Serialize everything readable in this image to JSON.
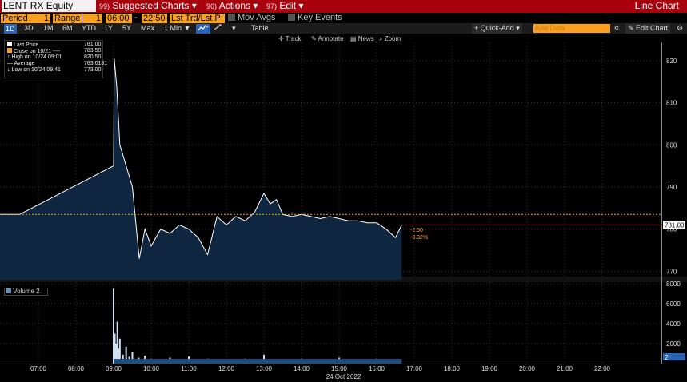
{
  "topbar": {
    "ticker": "LENT RX Equity",
    "menus": [
      {
        "num": "99)",
        "label": "Suggested Charts",
        "caret": "▾"
      },
      {
        "num": "96)",
        "label": "Actions",
        "caret": "▾"
      },
      {
        "num": "97)",
        "label": "Edit",
        "caret": "▾"
      }
    ],
    "title": "Line Chart"
  },
  "bar2": {
    "period_label": "Period",
    "period_value": "1",
    "range_label": "Range",
    "range_value": "1",
    "time_from": "06:00",
    "dash": "-",
    "time_to": "22:50",
    "field": "Lst Trd/Lst P",
    "mov_avgs": "Mov Avgs",
    "key_events": "Key Events"
  },
  "bar3": {
    "ranges": [
      "1D",
      "3D",
      "1M",
      "6M",
      "YTD",
      "1Y",
      "5Y",
      "Max"
    ],
    "selected": "1D",
    "interval": "1 Min ▼",
    "table": "Table",
    "quick_add": "+ Quick-Add ▾",
    "add_data_placeholder": "Add Data",
    "collapse": "«",
    "edit_chart": "✎ Edit Chart",
    "gear": "⚙"
  },
  "tools": {
    "track": "Track",
    "annotate": "Annotate",
    "news": "News",
    "zoom": "Zoom"
  },
  "legend": {
    "rows": [
      {
        "label": "Last Price",
        "value": "781.00",
        "color": "#ffffff"
      },
      {
        "label": "Close on 10/21 ----",
        "value": "783.50",
        "color": "#f9a020"
      },
      {
        "label": "High on 10/24 09:01",
        "value": "820.50",
        "color": ""
      },
      {
        "label": "Average",
        "value": "783.0131",
        "color": ""
      },
      {
        "label": "Low on 10/24 09:41",
        "value": "773.00",
        "color": ""
      }
    ]
  },
  "annotations": {
    "change": "-2.50",
    "change_pct": "-0.32%",
    "last_badge": "781.00"
  },
  "volume": {
    "legend": "Volume",
    "legend_count": "2",
    "badge": "2"
  },
  "date_label": "24 Oct 2022",
  "colors": {
    "topbar": "#a8000c",
    "accent_orange": "#f9a020",
    "area_fill": "#0f2640",
    "line": "#ffffff",
    "volume_fill": "#1f4d80"
  },
  "chart_data": [
    {
      "type": "area",
      "title": "",
      "x": [
        "06:30",
        "09:00",
        "09:01",
        "09:05",
        "09:10",
        "09:20",
        "09:30",
        "09:41",
        "09:50",
        "10:00",
        "10:15",
        "10:30",
        "10:45",
        "11:00",
        "11:15",
        "11:30",
        "11:45",
        "12:00",
        "12:15",
        "12:30",
        "12:45",
        "13:00",
        "13:10",
        "13:20",
        "13:30",
        "13:45",
        "14:00",
        "14:15",
        "14:30",
        "14:45",
        "15:00",
        "15:15",
        "15:30",
        "15:45",
        "16:00",
        "16:15",
        "16:30",
        "16:40"
      ],
      "series": [
        {
          "name": "",
          "values": [
            783.5,
            795.0,
            820.5,
            814.0,
            800.0,
            795.0,
            790.0,
            773.0,
            780.0,
            776.0,
            780.0,
            779.0,
            781.0,
            780.0,
            778.0,
            774.0,
            783.0,
            781.0,
            783.0,
            782.0,
            784.0,
            788.5,
            786.0,
            787.0,
            783.5,
            783.0,
            783.5,
            783.0,
            782.5,
            783.0,
            782.5,
            782.0,
            782.0,
            781.5,
            781.5,
            780.0,
            778.0,
            781.0
          ]
        }
      ],
      "xlabel": "",
      "ylabel": "",
      "ylim": [
        768,
        823
      ],
      "yticks": [
        770,
        780,
        790,
        800,
        810,
        820
      ],
      "reference_line": 783.5,
      "last_value": 781.0
    },
    {
      "type": "bar",
      "title": "",
      "x": [
        "09:00",
        "09:02",
        "09:04",
        "09:06",
        "09:08",
        "09:10",
        "09:15",
        "09:20",
        "09:25",
        "09:30",
        "09:40",
        "09:50",
        "10:00",
        "10:30",
        "11:00",
        "11:30",
        "12:00",
        "12:30",
        "13:00",
        "13:30",
        "14:00",
        "14:30",
        "15:00",
        "15:30",
        "16:00",
        "16:30"
      ],
      "series": [
        {
          "name": "Volume",
          "values": [
            7500,
            3000,
            2000,
            4200,
            1500,
            2500,
            900,
            1700,
            700,
            1200,
            600,
            800,
            500,
            600,
            700,
            500,
            400,
            500,
            900,
            400,
            500,
            400,
            600,
            400,
            500,
            300
          ]
        }
      ],
      "ylim": [
        0,
        8000
      ],
      "yticks": [
        2000,
        4000,
        6000,
        8000
      ],
      "last_value": 2
    }
  ],
  "xaxis": {
    "ticks": [
      "07:00",
      "08:00",
      "09:00",
      "10:00",
      "11:00",
      "12:00",
      "13:00",
      "14:00",
      "15:00",
      "16:00",
      "17:00",
      "18:00",
      "19:00",
      "20:00",
      "21:00",
      "22:00"
    ]
  }
}
